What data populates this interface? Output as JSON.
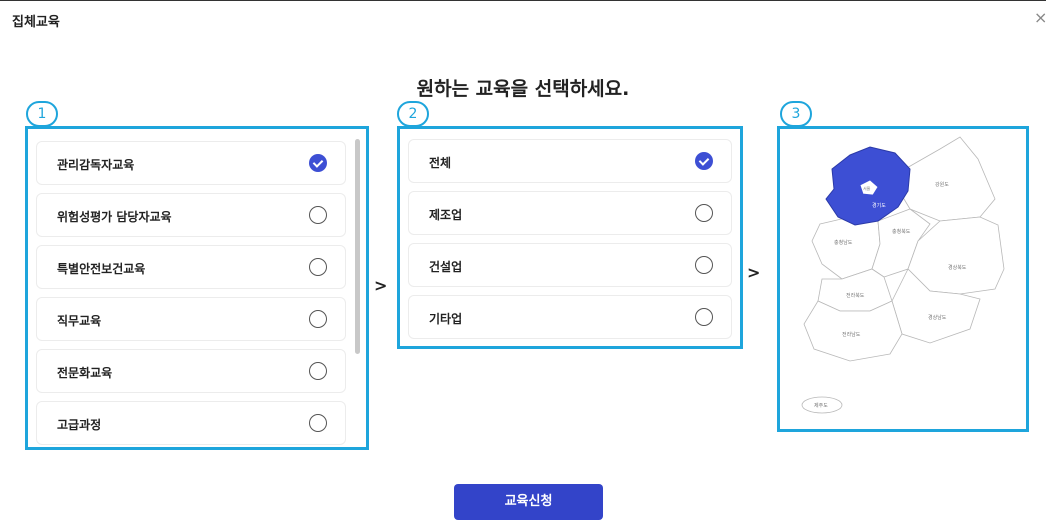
{
  "modal": {
    "title": "집체교육",
    "close": "×"
  },
  "prompt": "원하는 교육을 선택하세요.",
  "steps": [
    "1",
    "2",
    "3"
  ],
  "education_types": [
    {
      "label": "관리감독자교육",
      "selected": true
    },
    {
      "label": "위험성평가 담당자교육",
      "selected": false
    },
    {
      "label": "특별안전보건교육",
      "selected": false
    },
    {
      "label": "직무교육",
      "selected": false
    },
    {
      "label": "전문화교육",
      "selected": false
    },
    {
      "label": "고급과정",
      "selected": false
    }
  ],
  "industries": [
    {
      "label": "전체",
      "selected": true
    },
    {
      "label": "제조업",
      "selected": false
    },
    {
      "label": "건설업",
      "selected": false
    },
    {
      "label": "기타업",
      "selected": false
    }
  ],
  "map": {
    "selected_region": "경기도",
    "highlight_color": "#3d4fd4",
    "regions": [
      "서울",
      "경기도",
      "강원도",
      "충청북도",
      "충청남도",
      "경상북도",
      "전라북도",
      "경상남도",
      "전라남도",
      "제주도"
    ]
  },
  "arrows": [
    ">",
    ">"
  ],
  "apply_button": "교육신청",
  "colors": {
    "accent": "#3d4fd4",
    "annotation": "#1ea5dc",
    "button": "#3344c9"
  }
}
